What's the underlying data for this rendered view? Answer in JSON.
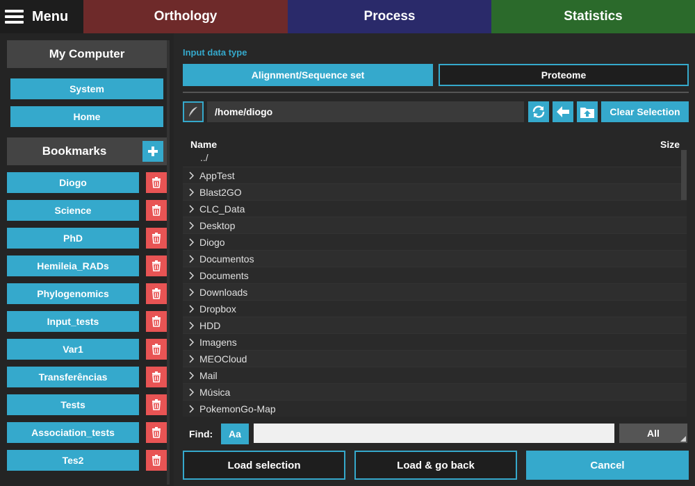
{
  "topbar": {
    "menu_label": "Menu",
    "tabs": [
      "Orthology",
      "Process",
      "Statistics"
    ]
  },
  "left": {
    "my_computer": "My Computer",
    "system": "System",
    "home": "Home",
    "bookmarks_title": "Bookmarks",
    "bookmarks": [
      "Diogo",
      "Science",
      "PhD",
      "Hemileia_RADs",
      "Phylogenomics",
      "Input_tests",
      "Var1",
      "Transferências",
      "Tests",
      "Association_tests",
      "Tes2"
    ]
  },
  "main": {
    "input_type_label": "Input data type",
    "alignment_label": "Alignment/Sequence set",
    "proteome_label": "Proteome",
    "path": "/home/diogo",
    "clear_selection": "Clear Selection",
    "col_name": "Name",
    "col_size": "Size",
    "parent_dir": "../",
    "files": [
      "AppTest",
      "Blast2GO",
      "CLC_Data",
      "Desktop",
      "Diogo",
      "Documentos",
      "Documents",
      "Downloads",
      "Dropbox",
      "HDD",
      "Imagens",
      "MEOCloud",
      "Mail",
      "Música",
      "PokemonGo-Map"
    ],
    "find_label": "Find:",
    "case_label": "Aa",
    "find_value": "",
    "all_label": "All",
    "load_selection": "Load selection",
    "load_go_back": "Load & go back",
    "cancel": "Cancel"
  },
  "colors": {
    "accent": "#35a9cc",
    "danger": "#e85454",
    "orthology": "#6e2a2a",
    "process": "#2a2a6a",
    "statistics": "#2b6a2b"
  }
}
